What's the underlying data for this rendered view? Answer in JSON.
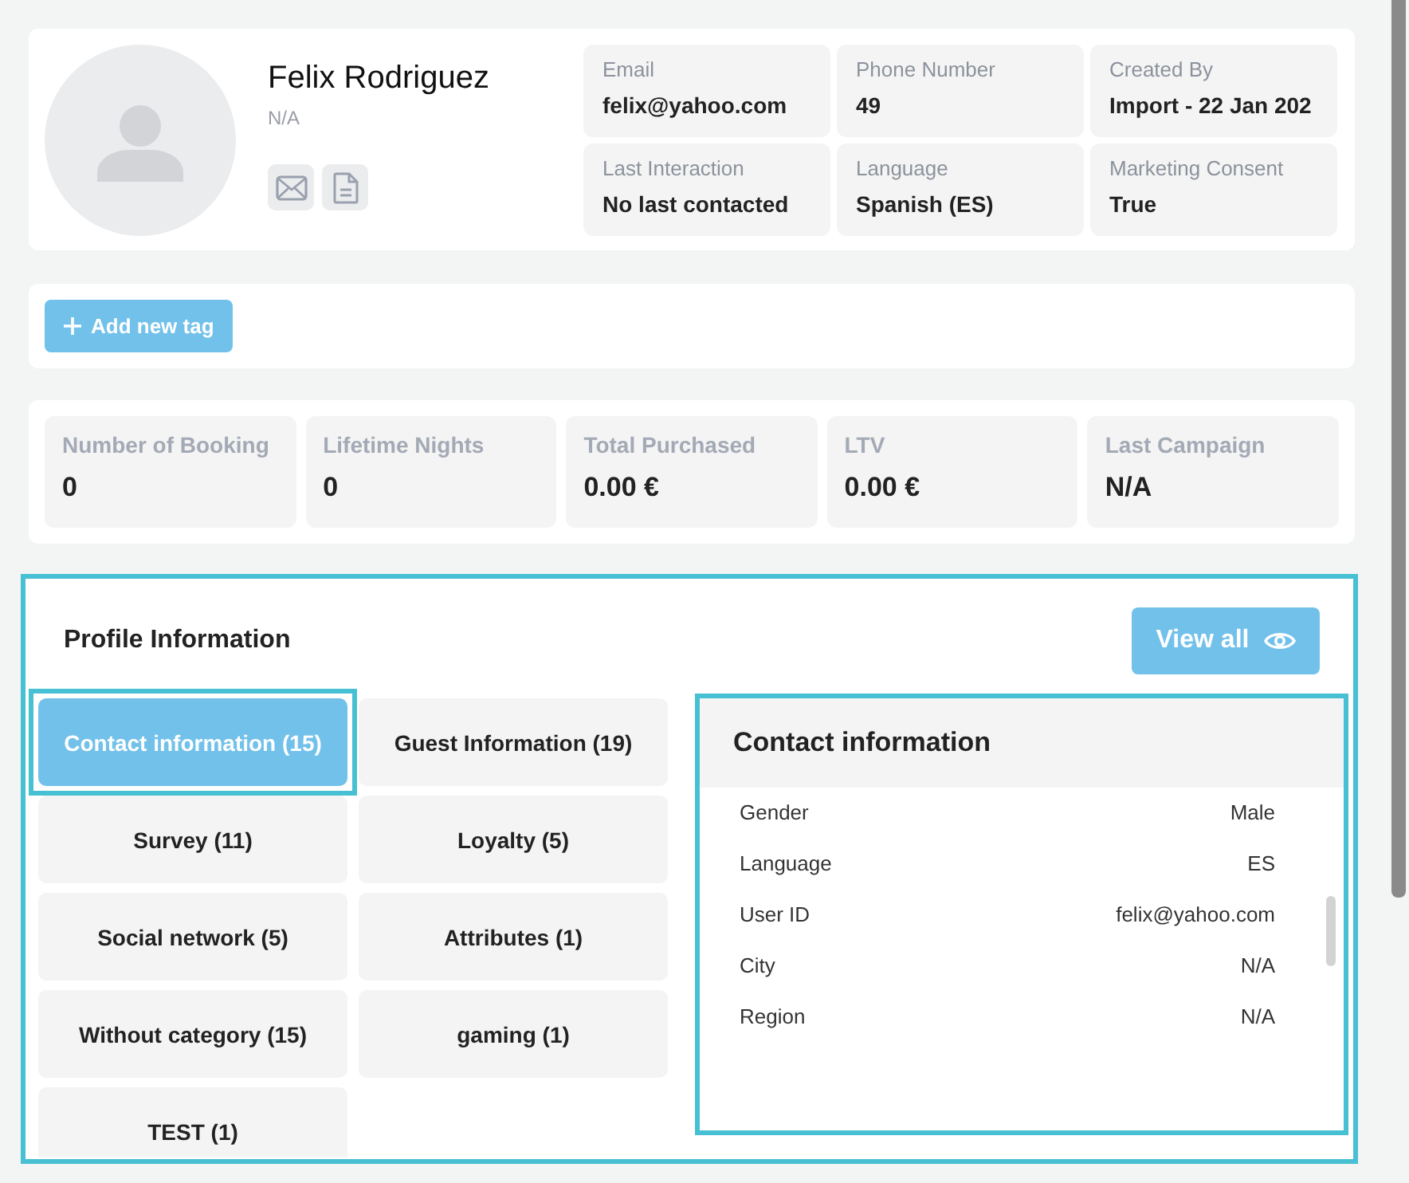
{
  "profile": {
    "name": "Felix Rodriguez",
    "subtitle": "N/A",
    "fields": [
      {
        "label": "Email",
        "value": "felix@yahoo.com"
      },
      {
        "label": "Phone Number",
        "value": "49"
      },
      {
        "label": "Created By",
        "value": "Import - 22 Jan 202"
      },
      {
        "label": "Last Interaction",
        "value": "No last contacted"
      },
      {
        "label": "Language",
        "value": "Spanish (ES)"
      },
      {
        "label": "Marketing Consent",
        "value": "True"
      }
    ]
  },
  "tags": {
    "add_button": "Add new tag"
  },
  "stats": [
    {
      "label": "Number of Booking",
      "value": "0"
    },
    {
      "label": "Lifetime Nights",
      "value": "0"
    },
    {
      "label": "Total Purchased",
      "value": "0.00 €"
    },
    {
      "label": "LTV",
      "value": "0.00 €"
    },
    {
      "label": "Last Campaign",
      "value": "N/A"
    }
  ],
  "profile_information": {
    "title": "Profile Information",
    "view_all": "View all",
    "categories": [
      {
        "label": "Contact information (15)",
        "selected": true
      },
      {
        "label": "Guest Information (19)",
        "selected": false
      },
      {
        "label": "Survey (11)",
        "selected": false
      },
      {
        "label": "Loyalty (5)",
        "selected": false
      },
      {
        "label": "Social network (5)",
        "selected": false
      },
      {
        "label": "Attributes (1)",
        "selected": false
      },
      {
        "label": "Without category (15)",
        "selected": false
      },
      {
        "label": "gaming (1)",
        "selected": false
      },
      {
        "label": "TEST (1)",
        "selected": false
      }
    ],
    "details": {
      "title": "Contact information",
      "rows": [
        {
          "label": "Gender",
          "value": "Male"
        },
        {
          "label": "Language",
          "value": "ES"
        },
        {
          "label": "User ID",
          "value": "felix@yahoo.com"
        },
        {
          "label": "City",
          "value": "N/A"
        },
        {
          "label": "Region",
          "value": "N/A"
        }
      ]
    }
  }
}
